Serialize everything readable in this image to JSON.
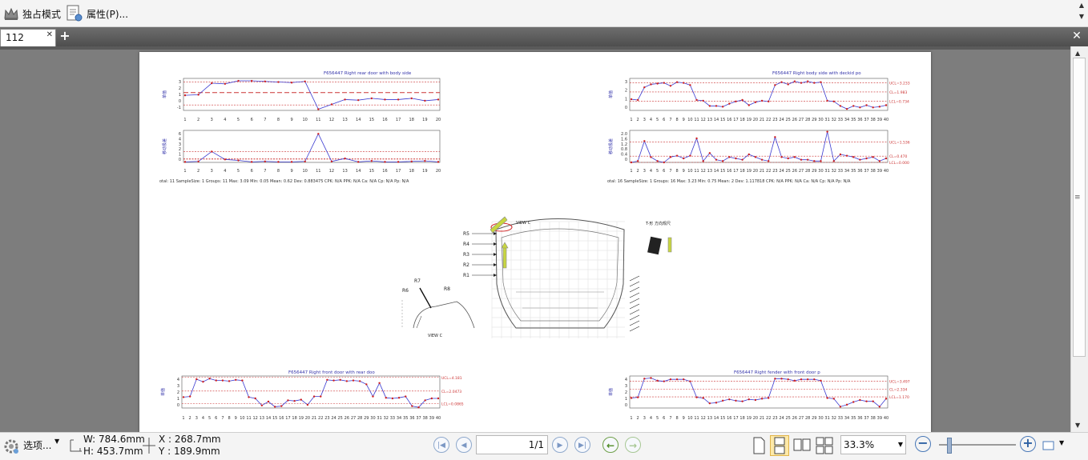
{
  "toolbar": {
    "exclusive_mode_label": "独占模式",
    "properties_label": "属性(P)..."
  },
  "tabs": {
    "active_label": "112"
  },
  "document": {
    "charts": [
      {
        "title": "F656447   Right rear door with body side",
        "x_ticks": [
          "1",
          "2",
          "3",
          "4",
          "5",
          "6",
          "7",
          "8",
          "9",
          "10",
          "11",
          "12",
          "13",
          "14",
          "15",
          "16",
          "17",
          "18",
          "19",
          "20"
        ],
        "top_ylabel": "单值",
        "bottom_ylabel": "移动极差",
        "top_yticks": [
          "3",
          "2",
          "1",
          "0",
          "-1"
        ],
        "bottom_yticks": [
          "6",
          "4",
          "3",
          "2",
          "1",
          "0"
        ],
        "stats": "otal: 11   SampleSize: 1   Groups: 11   Max: 3.09   Min: 0.05   Mean: 0.62   Dev: 0.883475   CPK: N/A   PPK: N/A   Ca: N/A   Cp: N/A   Pp: N/A"
      },
      {
        "title": "F656447   Right body side with deckid po",
        "x_ticks": [
          "1",
          "2",
          "3",
          "4",
          "5",
          "6",
          "7",
          "8",
          "9",
          "10",
          "11",
          "12",
          "13",
          "14",
          "15",
          "16",
          "17",
          "18",
          "19",
          "20",
          "21",
          "22",
          "23",
          "24",
          "25",
          "26",
          "27",
          "28",
          "29",
          "30",
          "31",
          "32",
          "33",
          "34",
          "35",
          "36",
          "37",
          "38",
          "39",
          "40"
        ],
        "top_ylabel": "单值",
        "bottom_ylabel": "移动极差",
        "top_yticks": [
          "3",
          "2",
          "1",
          "0"
        ],
        "bottom_yticks": [
          "2.0",
          "1.6",
          "1.2",
          "0.8",
          "0.4",
          "0"
        ],
        "ucl_top": "UCL=3.233",
        "cl_top": "CL=1.983",
        "lcl_top": "LCL=0.734",
        "ucl_bottom": "UCL=1.536",
        "cl_bottom": "CL=0.470",
        "lcl_bottom": "LCL=0.000",
        "stats": "otal: 16   SampleSize: 1   Groups: 16   Max: 3.23   Min: 0.75   Mean: 2   Dev: 1.117818   CPK: N/A   PPK: N/A   Ca: N/A   Cp: N/A   Pp: N/A"
      },
      {
        "title": "F656447   Right front door with rear doo",
        "top_ylabel": "单值",
        "top_yticks": [
          "4",
          "3",
          "2",
          "1",
          "0"
        ],
        "ucl": "UCL=4.181",
        "cl": "CL=2.0473",
        "lcl": "LCL=0.0865"
      },
      {
        "title": "F656447   Right fender with front door p",
        "top_ylabel": "单值",
        "top_yticks": [
          "4",
          "3",
          "2",
          "1",
          "0"
        ],
        "ucl": "UCL=3.497",
        "cl": "CL=2.334",
        "lcl": "LCL=1.170"
      }
    ],
    "diagram": {
      "view_label": "VIEW C",
      "labels": [
        "R5",
        "R4",
        "R3",
        "R2",
        "R1"
      ],
      "small_labels": [
        "R6",
        "R7",
        "R8"
      ],
      "view_c_bottom": "VIEW C",
      "gun_caption": "T-形 方向规尺"
    }
  },
  "status": {
    "options_label": "选项...",
    "width_label": "W: 784.6mm",
    "height_label": "H: 453.7mm",
    "x_label": "X : 268.7mm",
    "y_label": "Y : 189.9mm",
    "page_indicator": "1/1",
    "zoom": "33.3%"
  },
  "colors": {
    "series": "#3a3ad0",
    "point": "#d02020",
    "limit": "#cc3333",
    "tab_bar": "#5a5a5a",
    "canvas": "#7d7d7d"
  }
}
